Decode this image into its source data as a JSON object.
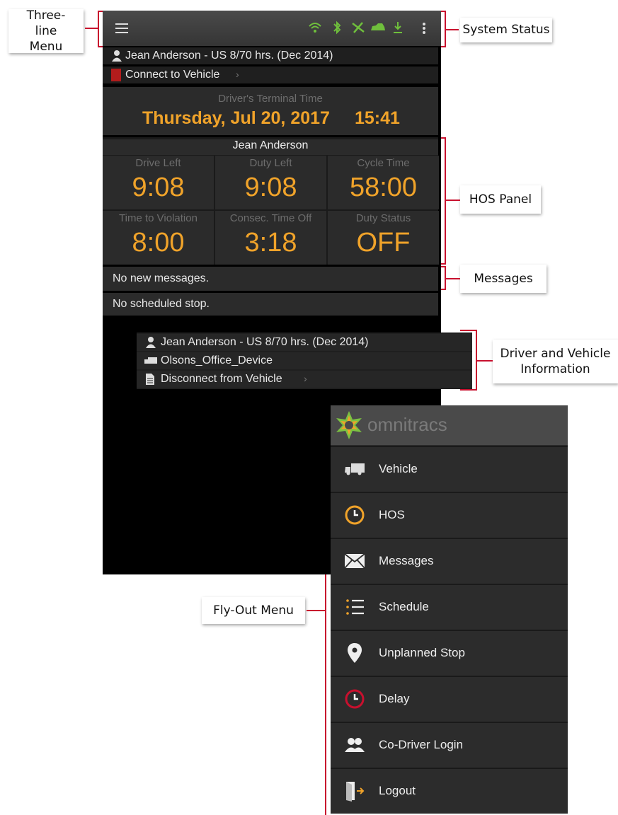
{
  "callouts": {
    "three_line_menu": "Three-line Menu",
    "system_status": "System Status",
    "hos_panel": "HOS Panel",
    "messages": "Messages",
    "driver_vehicle": "Driver and Vehicle Information",
    "fly_out": "Fly-Out Menu"
  },
  "top": {
    "driver_line": "Jean Anderson - US 8/70 hrs. (Dec 2014)",
    "connect_label": "Connect to Vehicle"
  },
  "terminal": {
    "heading": "Driver's Terminal Time",
    "date": "Thursday, Jul 20, 2017",
    "time": "15:41"
  },
  "hos": {
    "driver_name": "Jean Anderson",
    "cells": [
      {
        "label": "Drive Left",
        "value": "9:08"
      },
      {
        "label": "Duty Left",
        "value": "9:08"
      },
      {
        "label": "Cycle Time",
        "value": "58:00"
      },
      {
        "label": "Time to Violation",
        "value": "8:00"
      },
      {
        "label": "Consec. Time Off",
        "value": "3:18"
      },
      {
        "label": "Duty Status",
        "value": "OFF"
      }
    ]
  },
  "messages_text": "No new messages.",
  "stop_text": "No scheduled stop.",
  "driver_info": {
    "driver_line": "Jean Anderson - US 8/70 hrs. (Dec 2014)",
    "device": "Olsons_Office_Device",
    "disconnect_label": "Disconnect from Vehicle"
  },
  "flyout": {
    "brand": "omnitracs",
    "items": [
      {
        "label": "Vehicle",
        "icon": "truck-icon"
      },
      {
        "label": "HOS",
        "icon": "clock-icon"
      },
      {
        "label": "Messages",
        "icon": "envelope-icon"
      },
      {
        "label": "Schedule",
        "icon": "numbered-list-icon"
      },
      {
        "label": "Unplanned Stop",
        "icon": "map-pin-icon"
      },
      {
        "label": "Delay",
        "icon": "red-clock-icon"
      },
      {
        "label": "Co-Driver Login",
        "icon": "users-icon"
      },
      {
        "label": "Logout",
        "icon": "door-exit-icon"
      }
    ]
  },
  "colors": {
    "accent_orange": "#f0a32a",
    "status_green": "#6fbf3c",
    "callout_red": "#c8102e"
  }
}
